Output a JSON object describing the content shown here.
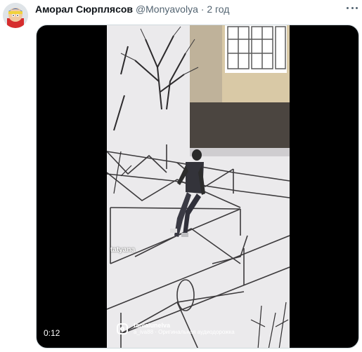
{
  "tweet": {
    "author_name": "Аморал Сюрплясов",
    "author_handle": "@Monyavolya",
    "separator": "·",
    "time": "2 год"
  },
  "video": {
    "duration": "0:12",
    "watermark_name": "tatyana",
    "ig_username": "tanialunelva",
    "ig_audio": "a_iva88 · Оригинальная аудиодорожка"
  },
  "colors": {
    "text_primary": "#0f1419",
    "text_secondary": "#536471",
    "video_bg": "#000000",
    "snow": "#e9e8ea"
  },
  "icons": [
    "more-icon",
    "instagram-icon"
  ]
}
